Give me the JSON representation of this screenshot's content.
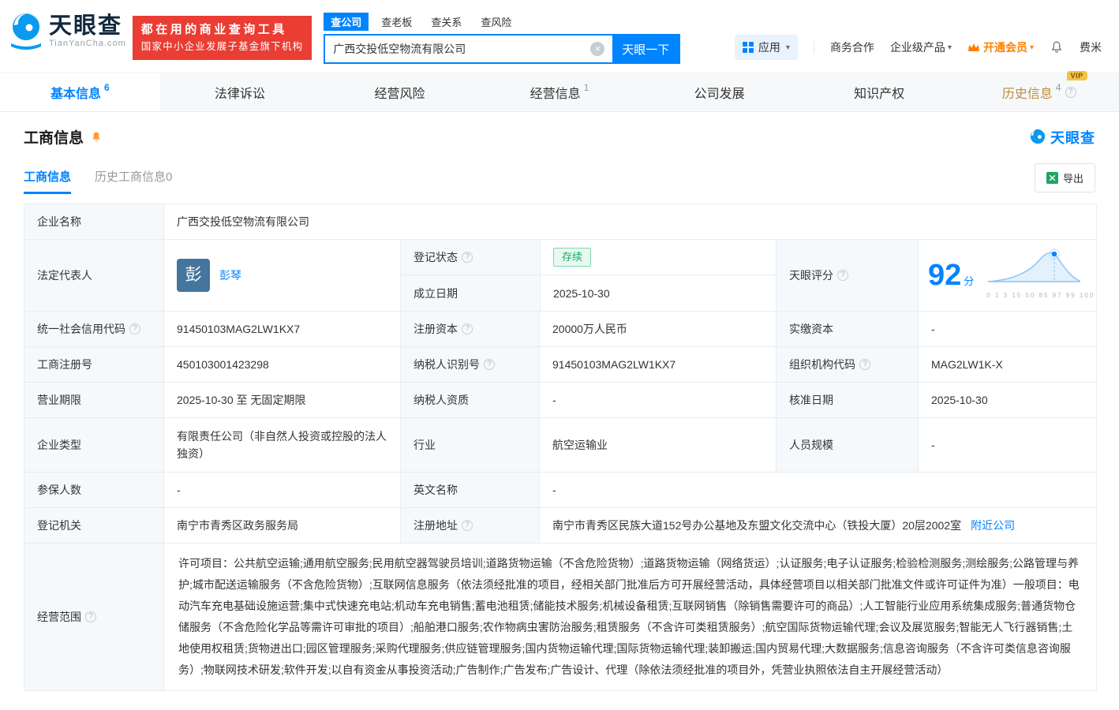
{
  "icons": {
    "help": "?",
    "caret": "▾",
    "clear": "×"
  },
  "header": {
    "logo": {
      "name": "天眼查",
      "domain": "TianYanCha.com"
    },
    "banner": {
      "line1": "都在用的商业查询工具",
      "line2": "国家中小企业发展子基金旗下机构"
    },
    "search": {
      "tabs": {
        "company": "查公司",
        "boss": "查老板",
        "relation": "查关系",
        "risk": "查风险"
      },
      "value": "广西交投低空物流有限公司",
      "submit": "天眼一下"
    },
    "apps_label": "应用",
    "links": {
      "cooperation": "商务合作",
      "enterprise": "企业级产品",
      "vip": "开通会员",
      "user": "费米"
    }
  },
  "nav": {
    "tabs": [
      {
        "label": "基本信息",
        "count": "6"
      },
      {
        "label": "法律诉讼",
        "count": ""
      },
      {
        "label": "经营风险",
        "count": ""
      },
      {
        "label": "经营信息",
        "count": "1"
      },
      {
        "label": "公司发展",
        "count": ""
      },
      {
        "label": "知识产权",
        "count": ""
      },
      {
        "label": "历史信息",
        "count": "4"
      }
    ],
    "vip_badge": "VIP"
  },
  "section": {
    "title": "工商信息",
    "brand": "天眼查",
    "tabs": {
      "current": "工商信息",
      "history": "历史工商信息0"
    },
    "export": "导出"
  },
  "table": {
    "company_name": {
      "label": "企业名称",
      "value": "广西交投低空物流有限公司"
    },
    "legal_rep": {
      "label": "法定代表人",
      "avatar_char": "彭",
      "name": "彭琴"
    },
    "reg_status": {
      "label": "登记状态",
      "value": "存续"
    },
    "establish_date": {
      "label": "成立日期",
      "value": "2025-10-30"
    },
    "score": {
      "label": "天眼评分",
      "value": "92",
      "unit": "分",
      "axis": "0 1 3 15 50 85 97 99 100"
    },
    "credit_code": {
      "label": "统一社会信用代码",
      "value": "91450103MAG2LW1KX7"
    },
    "reg_capital": {
      "label": "注册资本",
      "value": "20000万人民币"
    },
    "paid_capital": {
      "label": "实缴资本",
      "value": "-"
    },
    "reg_number": {
      "label": "工商注册号",
      "value": "450103001423298"
    },
    "taxpayer_id": {
      "label": "纳税人识别号",
      "value": "91450103MAG2LW1KX7"
    },
    "org_code": {
      "label": "组织机构代码",
      "value": "MAG2LW1K-X"
    },
    "business_term": {
      "label": "营业期限",
      "value": "2025-10-30 至 无固定期限"
    },
    "taxpayer_quality": {
      "label": "纳税人资质",
      "value": "-"
    },
    "approval_date": {
      "label": "核准日期",
      "value": "2025-10-30"
    },
    "company_type": {
      "label": "企业类型",
      "value": "有限责任公司（非自然人投资或控股的法人独资）"
    },
    "industry": {
      "label": "行业",
      "value": "航空运输业"
    },
    "staff_size": {
      "label": "人员规模",
      "value": "-"
    },
    "insured_count": {
      "label": "参保人数",
      "value": "-"
    },
    "english_name": {
      "label": "英文名称",
      "value": "-"
    },
    "reg_authority": {
      "label": "登记机关",
      "value": "南宁市青秀区政务服务局"
    },
    "reg_address": {
      "label": "注册地址",
      "value": "南宁市青秀区民族大道152号办公基地及东盟文化交流中心（铁投大厦）20层2002室",
      "near_link": "附近公司"
    },
    "business_scope": {
      "label": "经营范围",
      "value": "许可项目：公共航空运输;通用航空服务;民用航空器驾驶员培训;道路货物运输（不含危险货物）;道路货物运输（网络货运）;认证服务;电子认证服务;检验检测服务;测绘服务;公路管理与养护;城市配送运输服务（不含危险货物）;互联网信息服务（依法须经批准的项目，经相关部门批准后方可开展经营活动，具体经营项目以相关部门批准文件或许可证件为准）一般项目：电动汽车充电基础设施运营;集中式快速充电站;机动车充电销售;蓄电池租赁;储能技术服务;机械设备租赁;互联网销售（除销售需要许可的商品）;人工智能行业应用系统集成服务;普通货物仓储服务（不含危险化学品等需许可审批的项目）;船舶港口服务;农作物病虫害防治服务;租赁服务（不含许可类租赁服务）;航空国际货物运输代理;会议及展览服务;智能无人飞行器销售;土地使用权租赁;货物进出口;园区管理服务;采购代理服务;供应链管理服务;国内货物运输代理;国际货物运输代理;装卸搬运;国内贸易代理;大数据服务;信息咨询服务（不含许可类信息咨询服务）;物联网技术研发;软件开发;以自有资金从事投资活动;广告制作;广告发布;广告设计、代理（除依法须经批准的项目外，凭营业执照依法自主开展经营活动）"
    }
  }
}
